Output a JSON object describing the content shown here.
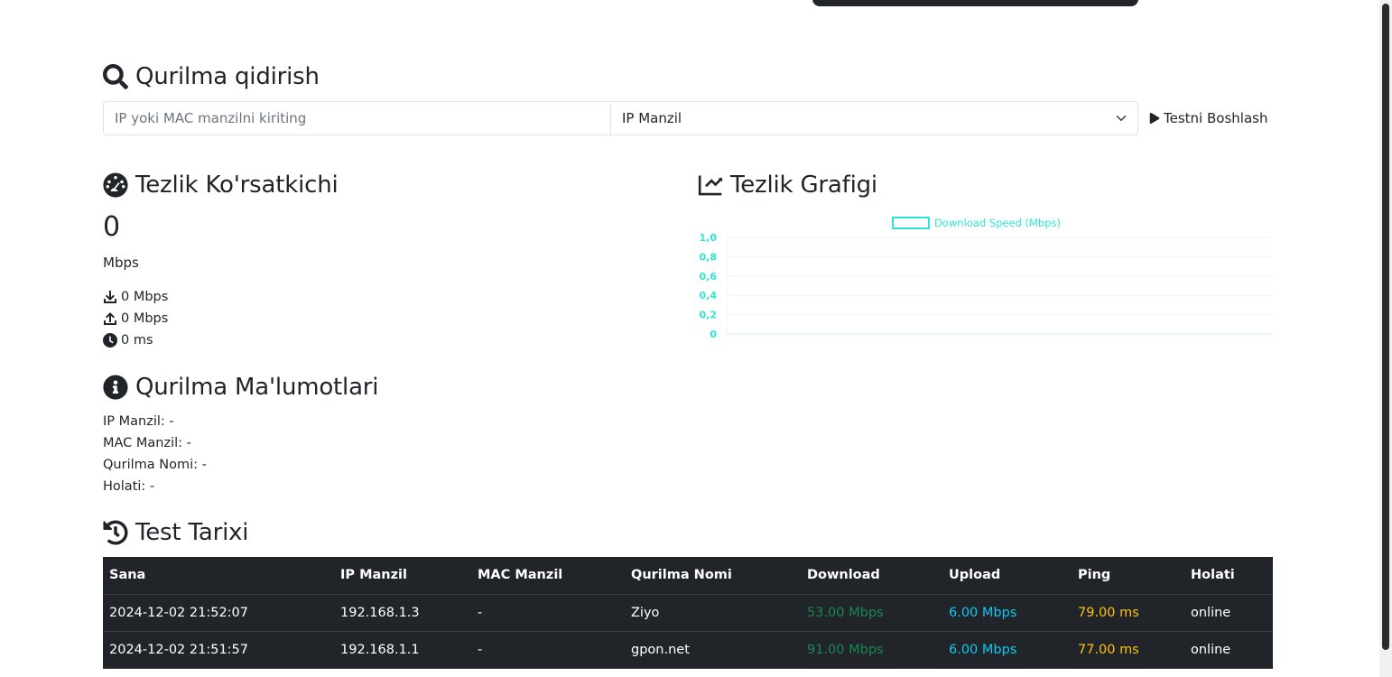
{
  "search": {
    "heading": "Qurilma qidirish",
    "placeholder": "IP yoki MAC manzilni kiriting",
    "select_value": "IP Manzil",
    "start_button": "Testni Boshlash"
  },
  "speed": {
    "heading": "Tezlik Ko'rsatkichi",
    "value": "0",
    "unit": "Mbps",
    "download": "0 Mbps",
    "upload": "0 Mbps",
    "ping": "0 ms"
  },
  "chart_section": {
    "heading": "Tezlik Grafigi"
  },
  "chart_data": {
    "type": "line",
    "title": "",
    "xlabel": "",
    "ylabel": "",
    "categories": [],
    "series": [
      {
        "name": "Download Speed (Mbps)",
        "values": []
      }
    ],
    "ylim": [
      0,
      1.0
    ],
    "y_ticks": [
      "0",
      "0,2",
      "0,4",
      "0,6",
      "0,8",
      "1,0"
    ],
    "grid": true,
    "legend": "top-center",
    "color": "#2ee6d6"
  },
  "info": {
    "heading": "Qurilma Ma'lumotlari",
    "ip": "IP Manzil: -",
    "mac": "MAC Manzil: -",
    "name": "Qurilma Nomi: -",
    "status": "Holati: -"
  },
  "history": {
    "heading": "Test Tarixi",
    "columns": [
      "Sana",
      "IP Manzil",
      "MAC Manzil",
      "Qurilma Nomi",
      "Download",
      "Upload",
      "Ping",
      "Holati"
    ],
    "rows": [
      [
        "2024-12-02 21:52:07",
        "192.168.1.3",
        "-",
        "Ziyo",
        "53.00 Mbps",
        "6.00 Mbps",
        "79.00 ms",
        "online"
      ],
      [
        "2024-12-02 21:51:57",
        "192.168.1.1",
        "-",
        "gpon.net",
        "91.00 Mbps",
        "6.00 Mbps",
        "77.00 ms",
        "online"
      ]
    ]
  },
  "colors": {
    "download": "#198754",
    "upload": "#0dcaf0",
    "ping": "#ffc107",
    "table_bg": "#212529"
  }
}
